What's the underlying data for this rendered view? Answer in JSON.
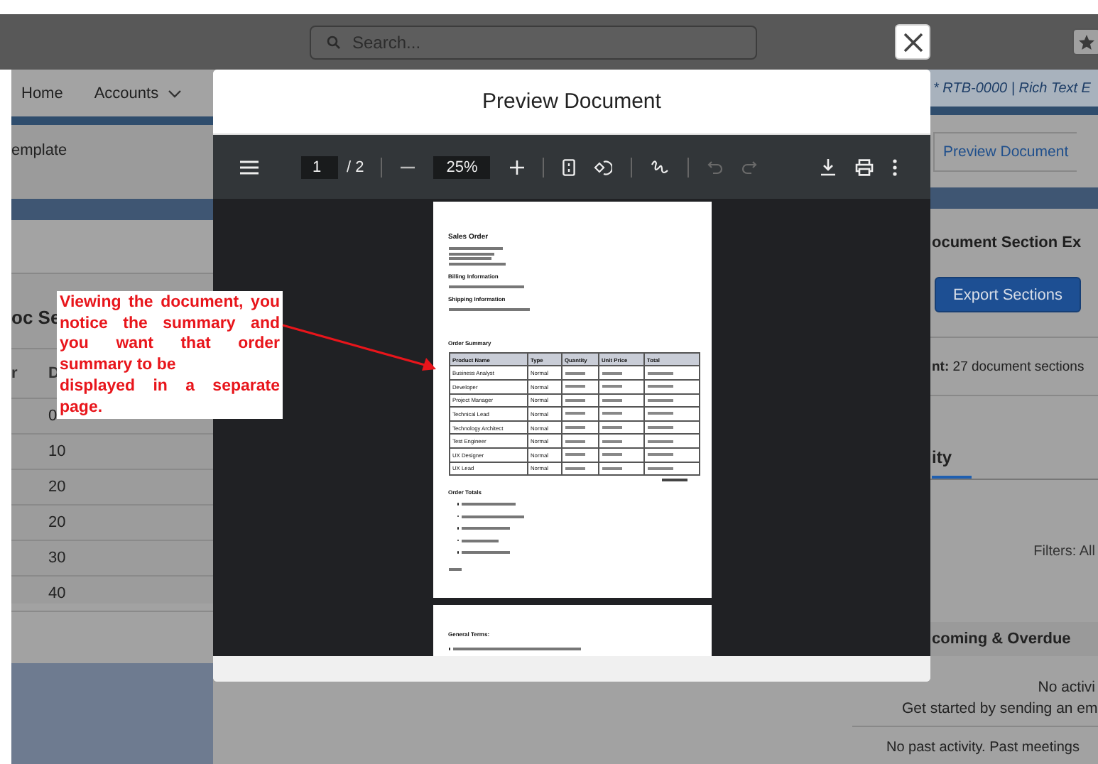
{
  "header": {
    "search": {
      "placeholder": "Search..."
    }
  },
  "nav": [
    {
      "label": "Home",
      "dropdown": false
    },
    {
      "label": "Accounts",
      "dropdown": true
    }
  ],
  "left_panel": {
    "breadcrumb": "emplate",
    "section_title": "oc Se",
    "columns": [
      "r",
      "D"
    ],
    "rows": [
      "0",
      "10",
      "20",
      "20",
      "30",
      "40"
    ]
  },
  "right_panel": {
    "record_title": "* RTB-0000 | Rich Text E",
    "preview_tab": "Preview Document",
    "section_title": "ocument Section Ex",
    "export_button": "Export Sections",
    "count_text": "**nt:** 27 document sections",
    "activity_tab": {
      "label": "ity",
      "selected": true
    },
    "filters": "Filters: All",
    "upcoming": "coming & Overdue",
    "empty_title": "No activi",
    "empty_text": "Get started by sending an em",
    "past_text": "No past activity. Past meetings"
  },
  "modal": {
    "title": "Preview Document",
    "viewer": {
      "page": "1",
      "page_count": "/ 2",
      "zoom": "25%",
      "undo": {
        "disabled": true
      },
      "redo": {
        "disabled": true
      }
    },
    "document": {
      "title": "Sales Order",
      "billing_heading": "Billing Information",
      "shipping_heading": "Shipping Information",
      "summary_heading": "Order Summary",
      "table": {
        "columns": [
          "Product Name",
          "Type",
          "Quantity",
          "Unit Price",
          "Total"
        ],
        "rows": [
          {
            "product": "Business Analyst",
            "type": "Normal"
          },
          {
            "product": "Developer",
            "type": "Normal"
          },
          {
            "product": "Project Manager",
            "type": "Normal"
          },
          {
            "product": "Technical Lead",
            "type": "Normal"
          },
          {
            "product": "Technology Architect",
            "type": "Normal"
          },
          {
            "product": "Test Engineer",
            "type": "Normal"
          },
          {
            "product": "UX Designer",
            "type": "Normal"
          },
          {
            "product": "UX Lead",
            "type": "Normal"
          }
        ]
      },
      "totals_heading": "Order Totals",
      "page2_heading": "General Terms:"
    }
  },
  "annotation": {
    "text": "Viewing the document, you notice the summary and you want that order summary to be\ndisplayed in a separate page."
  }
}
